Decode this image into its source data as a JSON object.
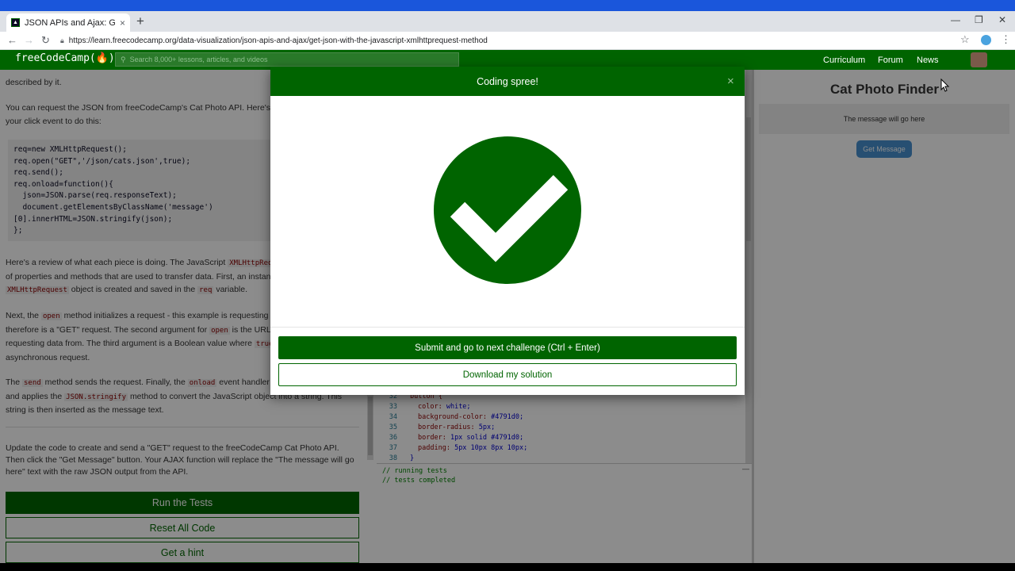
{
  "browser": {
    "tab_title": "JSON APIs and Ajax: Get JSON w",
    "tab_close": "×",
    "new_tab": "+",
    "url": "https://learn.freecodecamp.org/data-visualization/json-apis-and-ajax/get-json-with-the-javascript-xmlhttprequest-method",
    "window_controls": [
      "—",
      "❐",
      "✕"
    ]
  },
  "fcc_nav": {
    "logo": "freeCodeCamp(🔥)",
    "search_placeholder": "Search 8,000+ lessons, articles, and videos",
    "links": [
      "Curriculum",
      "Forum",
      "News"
    ]
  },
  "lesson": {
    "p0": "described by it.",
    "p1a": "You can request the JSON from freeCodeCamp's Cat Photo API. Here's t",
    "p1b": "your click event to do this:",
    "code_sample": "req=new XMLHttpRequest();\nreq.open(\"GET\",'/json/cats.json',true);\nreq.send();\nreq.onload=function(){\n  json=JSON.parse(req.responseText);\n  document.getElementsByClassName('message')\n[0].innerHTML=JSON.stringify(json);\n};",
    "p2_lines": [
      "Here's a review of what each piece is doing. The JavaScript",
      "of properties and methods that are used to transfer data. First, an instanc",
      "object is created and saved in the",
      "variable."
    ],
    "p2_code": [
      "XMLHttpRequ",
      "XMLHttpRequest",
      "req"
    ],
    "p3_lines": [
      "Next, the",
      "method initializes a request - this example is requesting d",
      "therefore is a \"GET\" request. The second argument for",
      "is the URL o",
      "requesting data from. The third argument is a Boolean value where",
      "asynchronous request."
    ],
    "p3_code": [
      "open",
      "open",
      "true"
    ],
    "p4_lines": [
      "The",
      "method sends the request. Finally, the",
      "event handler p",
      "and applies the",
      "method to convert the JavaScript object into a string. This",
      "string is then inserted as the message text."
    ],
    "p4_code": [
      "send",
      "onload",
      "JSON.stringify"
    ],
    "p5": "Update the code to create and send a \"GET\" request to the freeCodeCamp Cat Photo API. Then click the \"Get Message\" button. Your AJAX function will replace the \"The message will go here\" text with the raw JSON output from the API.",
    "run_tests": "Run the Tests",
    "reset_code": "Reset All Code",
    "get_hint": "Get a hint"
  },
  "editor": {
    "lines": [
      {
        "n": "32",
        "t": "button {"
      },
      {
        "n": "33",
        "k": "color:",
        "v": " white;"
      },
      {
        "n": "34",
        "k": "background-color:",
        "v": " #4791d0;"
      },
      {
        "n": "35",
        "k": "border-radius:",
        "v": " 5px;"
      },
      {
        "n": "36",
        "k": "border:",
        "v": " 1px solid #4791d0;"
      },
      {
        "n": "37",
        "k": "padding:",
        "v": " 5px 10px 8px 10px;"
      },
      {
        "n": "38",
        "t": "}"
      }
    ],
    "console": [
      "// running tests",
      "// tests completed"
    ]
  },
  "preview": {
    "title": "Cat Photo Finder",
    "message": "The message will go here",
    "button": "Get Message"
  },
  "modal": {
    "title": "Coding spree!",
    "close": "×",
    "submit": "Submit and go to next challenge (Ctrl + Enter)",
    "download": "Download my solution"
  },
  "colors": {
    "fcc_green": "#006400",
    "button_blue": "#4791d0"
  }
}
